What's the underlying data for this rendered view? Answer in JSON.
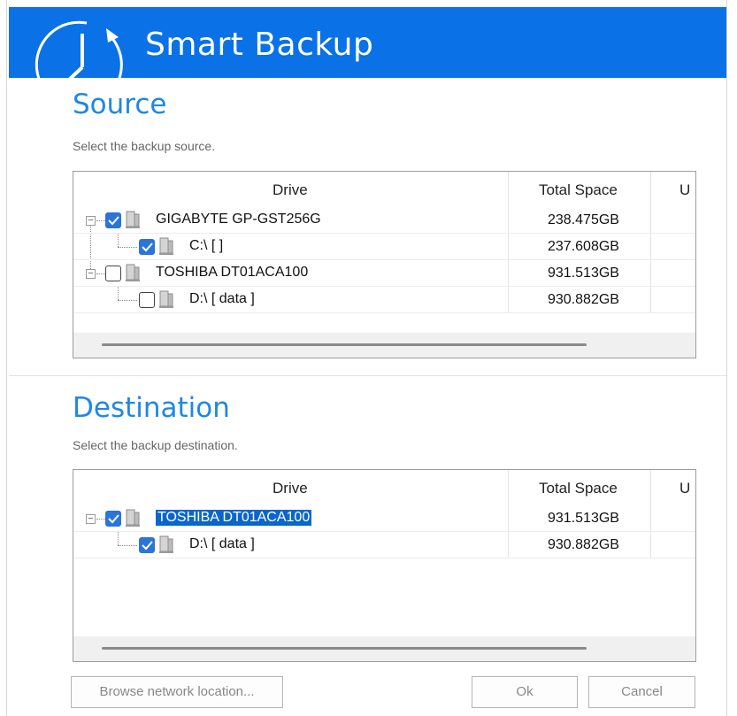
{
  "app": {
    "title": "Smart Backup"
  },
  "source": {
    "title": "Source",
    "subtitle": "Select the backup source.",
    "columns": [
      "Drive",
      "Total Space",
      "U"
    ],
    "rows": [
      {
        "name": "GIGABYTE GP-GST256G",
        "size": "238.475GB",
        "level": 0,
        "checked": true
      },
      {
        "name": "C:\\ [ ]",
        "size": "237.608GB",
        "level": 1,
        "checked": true
      },
      {
        "name": "TOSHIBA DT01ACA100",
        "size": "931.513GB",
        "level": 0,
        "checked": false
      },
      {
        "name": "D:\\ [ data ]",
        "size": "930.882GB",
        "level": 1,
        "checked": false
      }
    ]
  },
  "destination": {
    "title": "Destination",
    "subtitle": "Select the backup destination.",
    "columns": [
      "Drive",
      "Total Space",
      "U"
    ],
    "rows": [
      {
        "name": "TOSHIBA DT01ACA100",
        "size": "931.513GB",
        "level": 0,
        "checked": true,
        "selected": true
      },
      {
        "name": "D:\\ [ data ]",
        "size": "930.882GB",
        "level": 1,
        "checked": true
      }
    ]
  },
  "buttons": {
    "browse": "Browse network location...",
    "ok": "Ok",
    "cancel": "Cancel"
  },
  "colors": {
    "accent": "#0a72e6",
    "title": "#1e88e5",
    "checkbox": "#2b74d8",
    "selection": "#0a66cc"
  },
  "icons": [
    "clock-refresh-logo-icon",
    "drive-icon",
    "checkbox-checked-icon",
    "checkbox-unchecked-icon",
    "tree-collapse-icon"
  ]
}
